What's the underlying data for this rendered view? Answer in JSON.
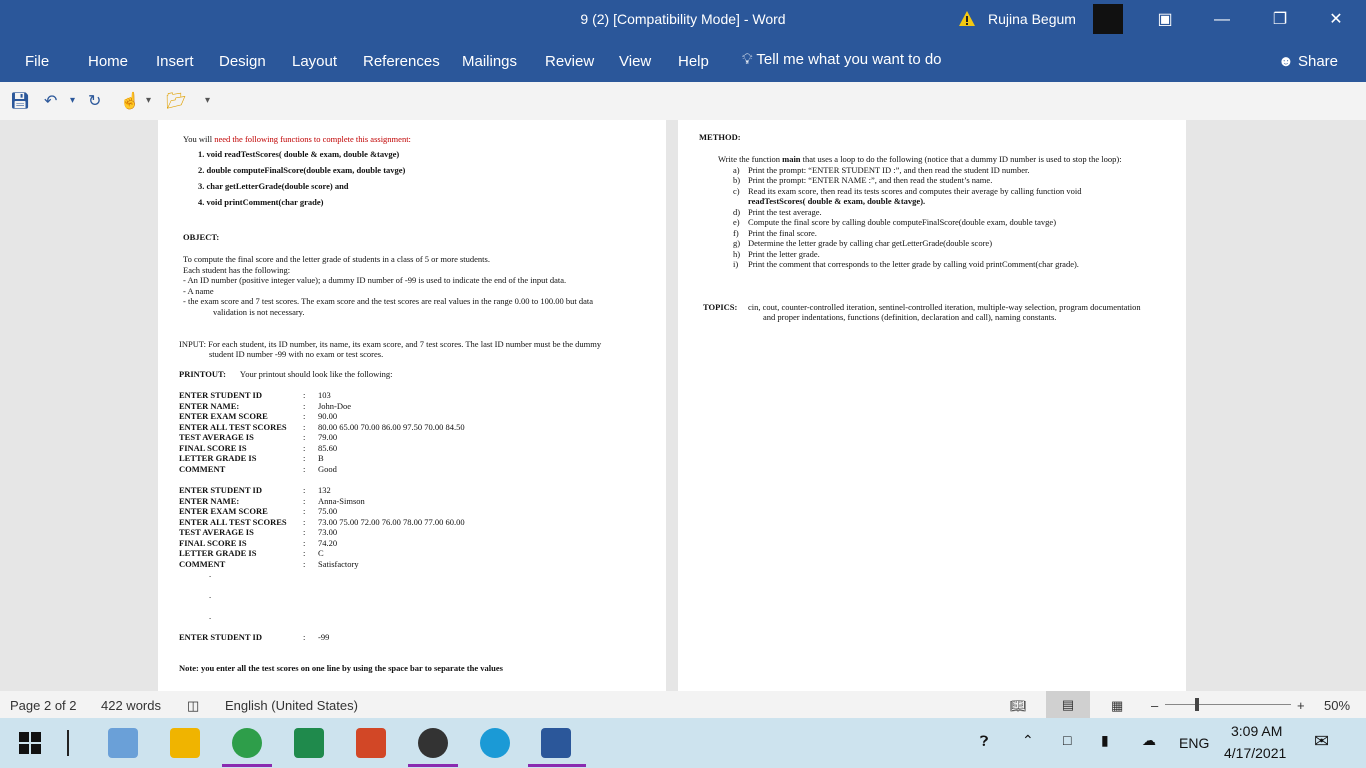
{
  "titlebar": {
    "doc_title": "9 (2) [Compatibility Mode]  -  Word",
    "user_name": "Rujina Begum"
  },
  "ribbon": {
    "tabs": [
      "File",
      "Home",
      "Insert",
      "Design",
      "Layout",
      "References",
      "Mailings",
      "Review",
      "View",
      "Help"
    ],
    "tell_me": "Tell me what you want to do",
    "share": "Share"
  },
  "left_page": {
    "intro_a": "You will ",
    "intro_b": "need the following functions to complete this assignment:",
    "functions": [
      "1. void readTestScores( double & exam, double &tavge)",
      "2. double computeFinalScore(double exam, double tavge)",
      "3. char getLetterGrade(double score)  and",
      "4. void  printComment(char grade)"
    ],
    "objective_heading": "OBJECT:",
    "objective_lines": [
      "To compute the final score and the letter grade of students in a class of 5 or more students.",
      "Each student has the following:",
      "-    An ID number (positive integer value); a dummy ID number of -99 is used to indicate the end of the input data.",
      "-    A name",
      "-    the exam score and 7 test scores.  The exam score and the test scores are real values in the range 0.00 to 100.00 but data",
      "validation is not necessary."
    ],
    "input_line1": "INPUT: For each student, its ID number, its name, its exam score, and 7 test scores. The last ID number must be the dummy",
    "input_line2": "student ID number -99 with no exam or test scores.",
    "printout_label": "PRINTOUT:",
    "printout_text": "Your printout should look like the following:",
    "student1": [
      {
        "k": "ENTER STUDENT ID",
        "v": "103"
      },
      {
        "k": "ENTER NAME:",
        "v": "John-Doe"
      },
      {
        "k": "ENTER EXAM SCORE",
        "v": "90.00"
      },
      {
        "k": "ENTER ALL TEST SCORES",
        "v": "80.00   65.00   70.00   86.00   97.50   70.00   84.50"
      },
      {
        "k": "TEST AVERAGE IS",
        "v": "79.00"
      },
      {
        "k": "FINAL SCORE IS",
        "v": "85.60"
      },
      {
        "k": "LETTER GRADE IS",
        "v": "B"
      },
      {
        "k": "COMMENT",
        "v": "Good"
      }
    ],
    "student2": [
      {
        "k": "ENTER STUDENT ID",
        "v": "132"
      },
      {
        "k": "ENTER NAME:",
        "v": "Anna-Simson"
      },
      {
        "k": "ENTER EXAM SCORE",
        "v": "75.00"
      },
      {
        "k": "ENTER ALL TEST SCORES",
        "v": "73.00   75.00   72.00   76.00   78.00   77.00   60.00"
      },
      {
        "k": "TEST AVERAGE IS",
        "v": "73.00"
      },
      {
        "k": "FINAL SCORE IS",
        "v": "74.20"
      },
      {
        "k": "LETTER GRADE IS",
        "v": "C"
      },
      {
        "k": "COMMENT",
        "v": "Satisfactory"
      }
    ],
    "dot": ".",
    "last_id_key": "ENTER STUDENT ID",
    "last_id_val": "-99",
    "note": "Note:  you enter all the test scores on one line by using the space bar to separate the values",
    "colon": ":"
  },
  "right_page": {
    "method_heading": "METHOD:",
    "method_intro_a": "Write the function ",
    "method_intro_b": "main",
    "method_intro_c": " that uses a loop to do the following (notice that a dummy ID number is used to stop the loop):",
    "steps": [
      {
        "l": "a)",
        "t": "Print the prompt: “ENTER STUDENT ID      :”, and then read the student ID number."
      },
      {
        "l": "b)",
        "t": "Print the prompt: “ENTER NAME        :”, and then read the student’s name."
      },
      {
        "l": "c)",
        "t": "Read  its  exam  score,  then  read  its  tests  scores  and  computes  their  average  by  calling  function  void"
      },
      {
        "l": "",
        "t": "readTestScores( double & exam, double &tavge)."
      },
      {
        "l": "d)",
        "t": "Print the test average."
      },
      {
        "l": "e)",
        "t": "Compute the final score by calling double computeFinalScore(double exam, double tavge)"
      },
      {
        "l": "f)",
        "t": "Print the final score."
      },
      {
        "l": "g)",
        "t": "Determine the letter grade by calling char getLetterGrade(double score)"
      },
      {
        "l": "h)",
        "t": "Print the letter grade."
      },
      {
        "l": "i)",
        "t": "Print the comment that corresponds to the letter grade by calling void  printComment(char grade)."
      }
    ],
    "topics_label": "TOPICS:",
    "topics_line1": "cin, cout, counter-controlled iteration, sentinel-controlled iteration, multiple-way selection, program documentation",
    "topics_line2": "and proper indentations, functions (definition, declaration and call), naming constants."
  },
  "statusbar": {
    "page": "Page 2 of 2",
    "words": "422 words",
    "language": "English (United States)",
    "zoom_minus": "–",
    "zoom_plus": "+",
    "zoom": "50%"
  },
  "taskbar": {
    "lang": "ENG",
    "time": "3:09 AM",
    "date": "4/17/2021"
  }
}
